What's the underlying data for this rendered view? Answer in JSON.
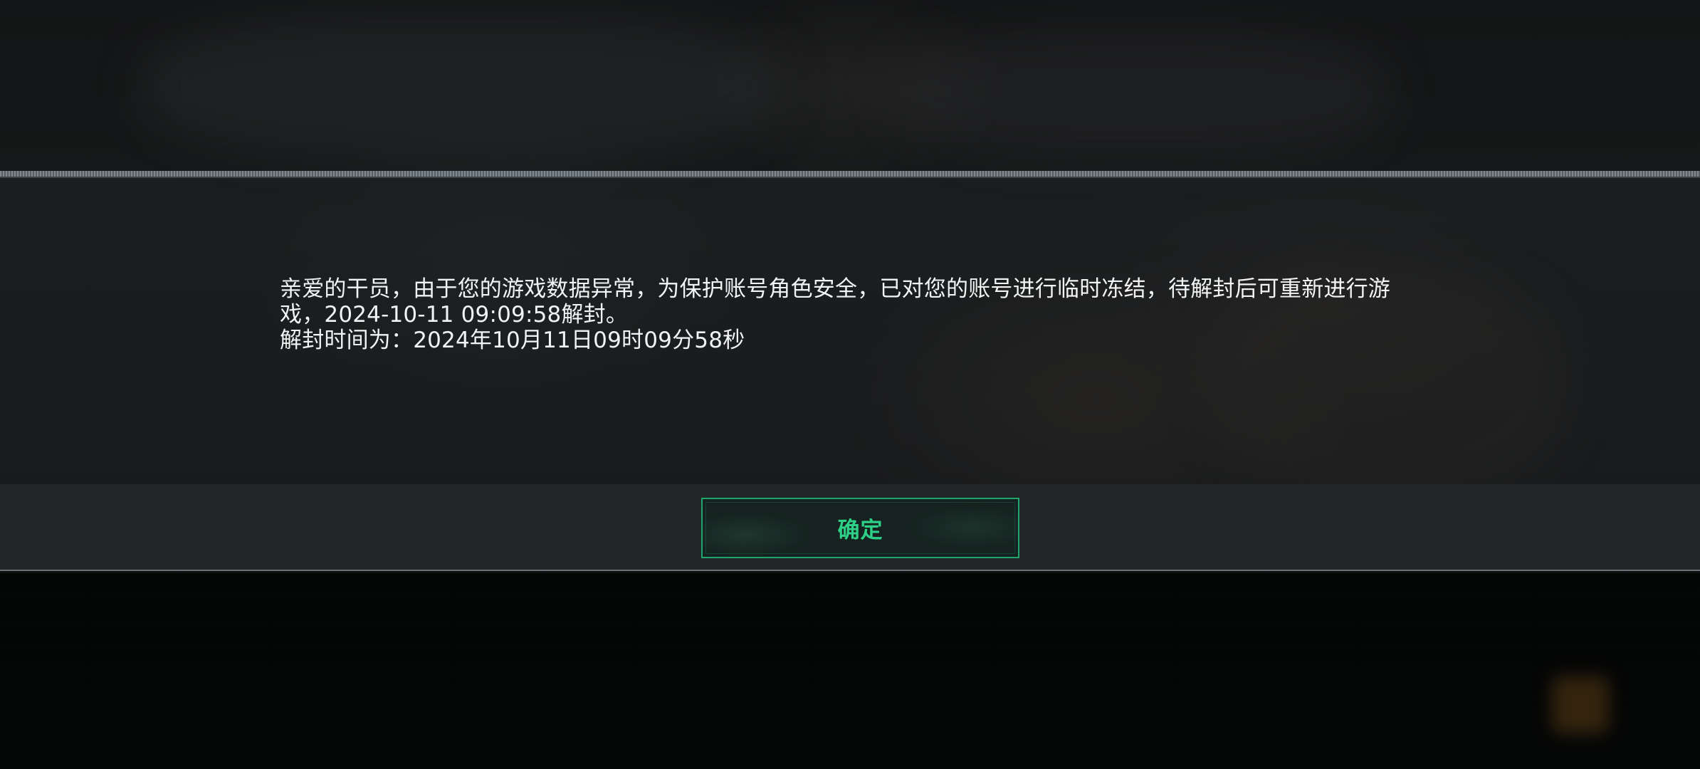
{
  "dialog": {
    "message_line1": "亲爱的干员，由于您的游戏数据异常，为保护账号角色安全，已对您的账号进行临时冻结，待解封后可重新进行游",
    "message_line2": "戏，2024-10-11 09:09:58解封。",
    "message_line3": "解封时间为：2024年10月11日09时09分58秒",
    "confirm_label": "确定"
  },
  "colors": {
    "accent": "#2ecf86",
    "button_border": "#1fa56e",
    "text": "#f2f3f4"
  }
}
